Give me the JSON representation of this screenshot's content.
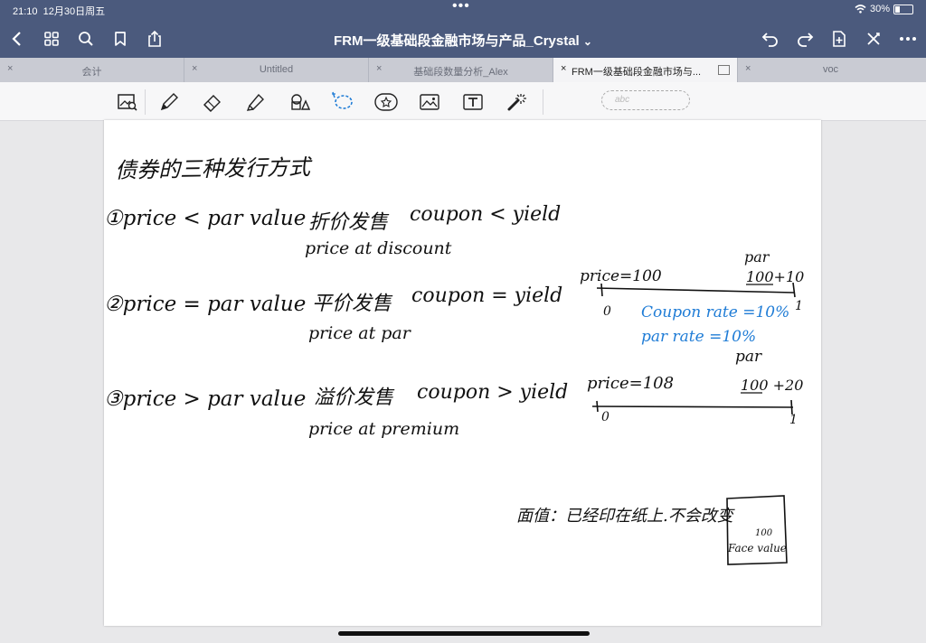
{
  "status": {
    "time": "21:10",
    "date": "12月30日周五",
    "battery": "30%",
    "battery_level": 0.3
  },
  "nav": {
    "title": "FRM一级基础段金融市场与产品_Crystal",
    "chevron": "⌄"
  },
  "tabs": [
    {
      "label": "会计",
      "active": false
    },
    {
      "label": "Untitled",
      "active": false
    },
    {
      "label": "基础段数量分析_Alex",
      "active": false
    },
    {
      "label": "FRM一级基础段金融市场与...",
      "active": true
    },
    {
      "label": "voc",
      "active": false
    }
  ],
  "toolbar": {
    "scribble_placeholder": "abc"
  },
  "note": {
    "heading": "债券的三种发行方式",
    "row1": {
      "label": "①price < par value",
      "zh": "折价发售",
      "rel": "coupon < yield",
      "en": "price at discount"
    },
    "row2": {
      "label": "②price = par value",
      "zh": "平价发售",
      "rel": "coupon = yield",
      "en": "price at par"
    },
    "row3": {
      "label": "③price > par value",
      "zh": "溢价发售",
      "rel": "coupon > yield",
      "en": "price at premium"
    },
    "diag1": {
      "price": "price=100",
      "par": "par",
      "flow": "100+10",
      "t0": "0",
      "t1": "1"
    },
    "blue1": "Coupon rate =10%",
    "blue2": "par rate =10%",
    "diag2": {
      "par": "par",
      "price": "price=108",
      "flow": "100 +20",
      "t0": "0",
      "t1": "1"
    },
    "face_note": "面值：已经印在纸上.不会改变",
    "box_num": "100",
    "box_label": "Face value"
  }
}
